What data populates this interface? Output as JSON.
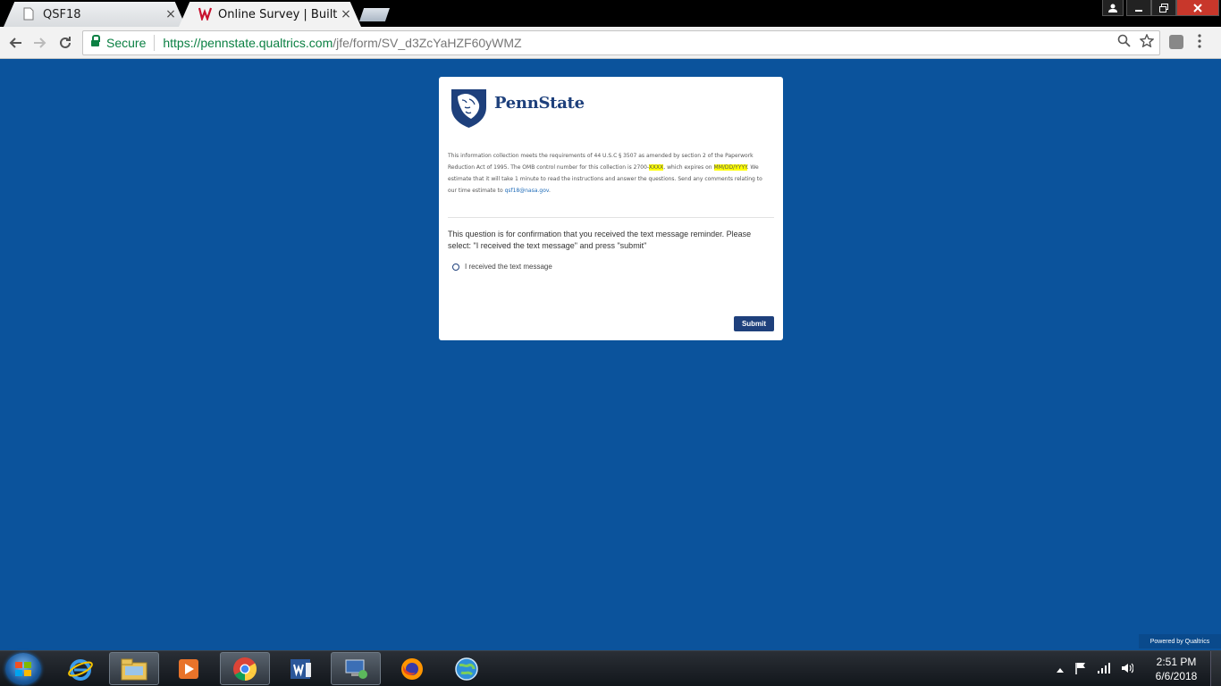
{
  "browser": {
    "tabs": [
      {
        "title": "QSF18",
        "close": "×"
      },
      {
        "title": "Online Survey | Built with",
        "close": "×"
      }
    ],
    "address": {
      "secure_label": "Secure",
      "url_host": "https://pennstate.qualtrics.com",
      "url_path": "/jfe/form/SV_d3ZcYaHZF60yWMZ"
    }
  },
  "survey": {
    "logo_text": "PennState",
    "disclaimer": {
      "part1": "This information collection meets the requirements of 44 U.S.C § 3507 as amended by section 2 of the Paperwork Reduction Act of 1995. The OMB control number for this collection is 2700-",
      "control_number": "XXXX",
      "part2": ", which expires on ",
      "expiry": "MM/DD/YYYY",
      "part3": ".  We estimate that it will take 1 minute to read the instructions and answer the questions.  Send any comments relating to our time estimate to ",
      "email": "qsf18@nasa.gov",
      "part4": "."
    },
    "question": "This question is for confirmation that you received the text message reminder.  Please select: \"I received the text message\" and press \"submit\"",
    "choice": "I received the text message",
    "submit": "Submit",
    "powered_by": "Powered by Qualtrics"
  },
  "taskbar": {
    "time": "2:51 PM",
    "date": "6/6/2018"
  },
  "colors": {
    "page_background": "#0b539c",
    "penn_state_navy": "#1e407c",
    "secure_green": "#0b8043",
    "highlight_yellow": "#ffff00"
  }
}
